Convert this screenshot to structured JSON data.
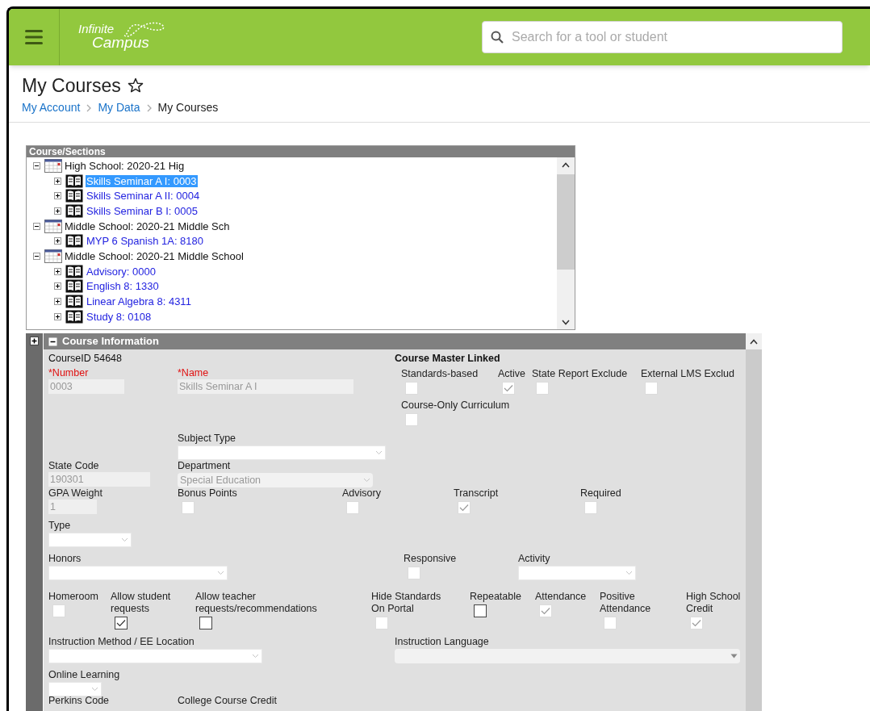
{
  "header": {
    "logo_top": "Infinite",
    "logo_bottom": "Campus",
    "search": {
      "placeholder": "Search for a tool or student"
    }
  },
  "page": {
    "title": "My Courses",
    "breadcrumb": [
      "My Account",
      "My Data",
      "My Courses"
    ]
  },
  "tree": {
    "title": "Course/Sections",
    "nodes": [
      {
        "kind": "school",
        "label": "High School: 2020-21 Hig",
        "expanded": true,
        "children": [
          {
            "kind": "course",
            "label": "Skills Seminar A I: 0003",
            "expanded": false,
            "selected": true
          },
          {
            "kind": "course",
            "label": "Skills Seminar A II: 0004",
            "expanded": false,
            "selected": false
          },
          {
            "kind": "course",
            "label": "Skills Seminar B I: 0005",
            "expanded": false,
            "selected": false
          }
        ]
      },
      {
        "kind": "school",
        "label": "Middle School: 2020-21 Middle Sch",
        "expanded": true,
        "children": [
          {
            "kind": "course",
            "label": "MYP 6 Spanish 1A: 8180",
            "expanded": false,
            "selected": false
          }
        ]
      },
      {
        "kind": "school",
        "label": "Middle School: 2020-21 Middle School",
        "expanded": true,
        "children": [
          {
            "kind": "course",
            "label": "Advisory: 0000",
            "expanded": false,
            "selected": false
          },
          {
            "kind": "course",
            "label": "English 8: 1330",
            "expanded": false,
            "selected": false
          },
          {
            "kind": "course",
            "label": "Linear Algebra 8: 4311",
            "expanded": false,
            "selected": false
          },
          {
            "kind": "course",
            "label": "Study 8: 0108",
            "expanded": false,
            "selected": false
          }
        ]
      }
    ]
  },
  "course_info": {
    "title": "Course Information",
    "expanded": true,
    "items": [
      {
        "kind": "heading",
        "label": "CourseID 54648"
      },
      {
        "kind": "text",
        "label": "*Number",
        "required": true,
        "value": "0003"
      },
      {
        "kind": "text",
        "label": "*Name",
        "required": true,
        "value": "Skills Seminar A I"
      },
      {
        "kind": "heading",
        "label": "Course Master Linked"
      },
      {
        "kind": "checkbox",
        "label": "Standards-based",
        "checked": false,
        "disabled": true
      },
      {
        "kind": "checkbox",
        "label": "Active",
        "checked": true,
        "disabled": true
      },
      {
        "kind": "checkbox",
        "label": "State Report Exclude",
        "checked": false,
        "disabled": true
      },
      {
        "kind": "checkbox",
        "label": "External LMS Exclud",
        "checked": false,
        "disabled": true
      },
      {
        "kind": "checkbox",
        "label": "Course-Only Curriculum",
        "checked": false,
        "disabled": true
      },
      {
        "kind": "select",
        "label": "Subject Type",
        "disabled": false
      },
      {
        "kind": "text",
        "label": "State Code",
        "required": false,
        "value": "190301"
      },
      {
        "kind": "select",
        "label": "Department",
        "value": "Special Education",
        "disabled": true
      },
      {
        "kind": "text",
        "label": "GPA Weight",
        "required": false,
        "value": "1"
      },
      {
        "kind": "checkbox",
        "label": "Bonus Points",
        "checked": false,
        "disabled": true
      },
      {
        "kind": "checkbox",
        "label": "Advisory",
        "checked": false,
        "disabled": true
      },
      {
        "kind": "checkbox",
        "label": "Transcript",
        "checked": true,
        "disabled": true
      },
      {
        "kind": "checkbox",
        "label": "Required",
        "checked": false,
        "disabled": true
      },
      {
        "kind": "select",
        "label": "Type",
        "disabled": false
      },
      {
        "kind": "select",
        "label": "Honors",
        "disabled": false
      },
      {
        "kind": "checkbox",
        "label": "Responsive",
        "checked": false,
        "disabled": true
      },
      {
        "kind": "select",
        "label": "Activity",
        "disabled": false
      },
      {
        "kind": "checkbox",
        "label": "Homeroom",
        "checked": false,
        "disabled": true
      },
      {
        "kind": "checkbox",
        "label": "Allow student requests",
        "checked": true,
        "disabled": false
      },
      {
        "kind": "checkbox",
        "label": "Allow teacher requests/recommendations",
        "checked": false,
        "disabled": false
      },
      {
        "kind": "checkbox",
        "label": "Hide Standards On Portal",
        "checked": false,
        "disabled": true
      },
      {
        "kind": "checkbox",
        "label": "Repeatable",
        "checked": false,
        "disabled": false
      },
      {
        "kind": "checkbox",
        "label": "Attendance",
        "checked": true,
        "disabled": true
      },
      {
        "kind": "checkbox",
        "label": "Positive Attendance",
        "checked": false,
        "disabled": true
      },
      {
        "kind": "checkbox",
        "label": "High School Credit",
        "checked": true,
        "disabled": true
      },
      {
        "kind": "select",
        "label": "Instruction Method / EE Location",
        "disabled": false
      },
      {
        "kind": "select",
        "label": "Instruction Language",
        "disabled": true
      },
      {
        "kind": "select",
        "label": "Online Learning",
        "disabled": false
      },
      {
        "kind": "label",
        "label": "Perkins Code"
      },
      {
        "kind": "label",
        "label": "College Course Credit"
      }
    ]
  }
}
